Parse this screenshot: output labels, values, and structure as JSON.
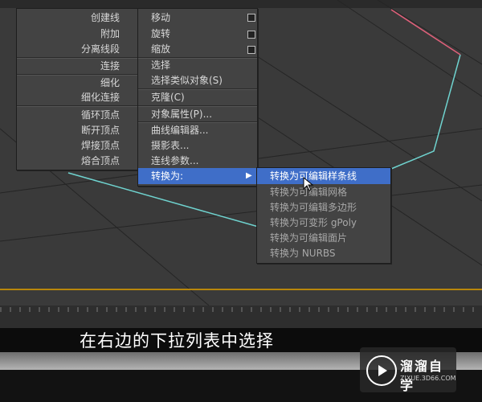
{
  "left_menu": {
    "items": [
      "创建线",
      "附加",
      "分离线段",
      "连接",
      "细化",
      "细化连接",
      "循环顶点",
      "断开顶点",
      "焊接顶点",
      "熔合顶点"
    ]
  },
  "mid_menu": {
    "items": [
      "移动",
      "旋转",
      "缩放",
      "选择",
      "选择类似对象(S)",
      "克隆(C)",
      "对象属性(P)...",
      "曲线编辑器...",
      "摄影表...",
      "连线参数...",
      "转换为:"
    ]
  },
  "submenu": {
    "items": [
      "转换为可编辑样条线",
      "转换为可编辑网格",
      "转换为可编辑多边形",
      "转换为可变形 gPoly",
      "转换为可编辑面片",
      "转换为 NURBS"
    ]
  },
  "caption": "在右边的下拉列表中选择",
  "logo": {
    "name": "溜溜自学",
    "url": "ZIXUE.3D66.COM"
  },
  "colors": {
    "highlight": "#3f6ec8",
    "spline": "#6fd3cf",
    "ground_line": "#b8860b"
  }
}
